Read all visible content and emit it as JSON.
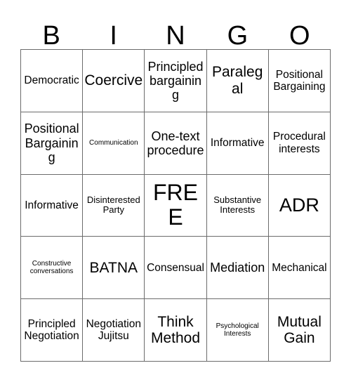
{
  "card": {
    "title": "BINGO",
    "header_letters": [
      "B",
      "I",
      "N",
      "G",
      "O"
    ],
    "grid_size": "5x5",
    "free_space": "FREE",
    "colors": {
      "background": "#ffffff",
      "border": "#6b6b6b",
      "text": "#000000"
    },
    "rows": [
      [
        {
          "text": "Democratic",
          "size": "md"
        },
        {
          "text": "Coercive",
          "size": "xl"
        },
        {
          "text": "Principled bargaining",
          "size": "lg"
        },
        {
          "text": "Paralegal",
          "size": "xl"
        },
        {
          "text": "Positional Bargaining",
          "size": "md"
        }
      ],
      [
        {
          "text": "Positional Bargaining",
          "size": "lg"
        },
        {
          "text": "Communication",
          "size": "xs"
        },
        {
          "text": "One-text procedure",
          "size": "lg"
        },
        {
          "text": "Informative",
          "size": "md"
        },
        {
          "text": "Procedural interests",
          "size": "md"
        }
      ],
      [
        {
          "text": "Informative",
          "size": "md"
        },
        {
          "text": "Disinterested Party",
          "size": "sm"
        },
        {
          "text": "FREE",
          "size": "free"
        },
        {
          "text": "Substantive Interests",
          "size": "sm"
        },
        {
          "text": "ADR",
          "size": "xxl"
        }
      ],
      [
        {
          "text": "Constructive conversations",
          "size": "xs"
        },
        {
          "text": "BATNA",
          "size": "xl"
        },
        {
          "text": "Consensual",
          "size": "md"
        },
        {
          "text": "Mediation",
          "size": "lg"
        },
        {
          "text": "Mechanical",
          "size": "md"
        }
      ],
      [
        {
          "text": "Principled Negotiation",
          "size": "md"
        },
        {
          "text": "Negotiation Jujitsu",
          "size": "md"
        },
        {
          "text": "Think Method",
          "size": "xl"
        },
        {
          "text": "Psychological Interests",
          "size": "xs"
        },
        {
          "text": "Mutual Gain",
          "size": "xl"
        }
      ]
    ]
  }
}
